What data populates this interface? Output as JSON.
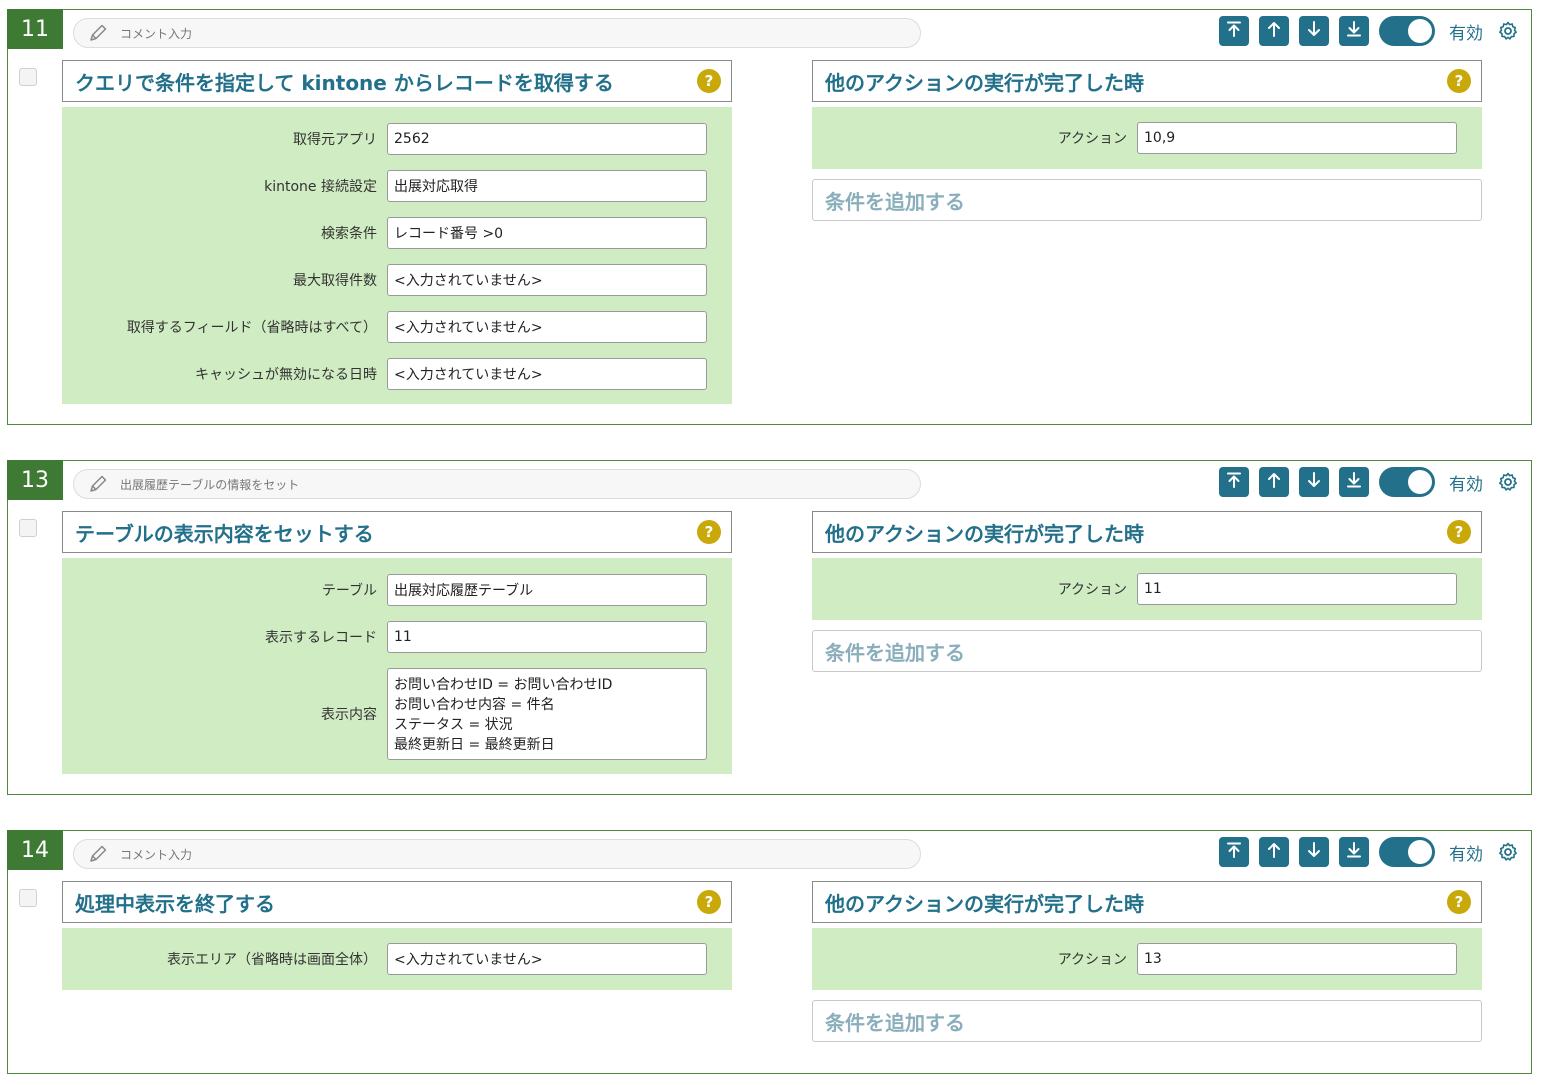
{
  "colors": {
    "accent": "#22708a",
    "block_number_bg": "#3f7a34",
    "panel_bg": "#d0ecc3",
    "help": "#c9a80a"
  },
  "toolbar": {
    "icons": [
      "move-top-icon",
      "move-up-icon",
      "move-down-icon",
      "move-bottom-icon"
    ],
    "enabled_label": "有効"
  },
  "blocks": [
    {
      "number": "11",
      "comment": "コメント入力",
      "action_title": "クエリで条件を指定して kintone からレコードを取得する",
      "fields": [
        {
          "label": "取得元アプリ",
          "value": "2562"
        },
        {
          "label": "kintone 接続設定",
          "value": "出展対応取得"
        },
        {
          "label": "検索条件",
          "value": "レコード番号 >0"
        },
        {
          "label": "最大取得件数",
          "value": "<入力されていません>"
        },
        {
          "label": "取得するフィールド（省略時はすべて）",
          "value": "<入力されていません>"
        },
        {
          "label": "キャッシュが無効になる日時",
          "value": "<入力されていません>"
        }
      ],
      "trigger_title": "他のアクションの実行が完了した時",
      "trigger_label": "アクション",
      "trigger_value": "10,9",
      "add_condition": "条件を追加する"
    },
    {
      "number": "13",
      "comment": "出展履歴テーブルの情報をセット",
      "action_title": "テーブルの表示内容をセットする",
      "fields": [
        {
          "label": "テーブル",
          "value": "出展対応履歴テーブル"
        },
        {
          "label": "表示するレコード",
          "value": "11"
        },
        {
          "label": "表示内容",
          "value": "お問い合わせID = お問い合わせID\nお問い合わせ内容 = 件名\nステータス = 状況\n最終更新日 = 最終更新日"
        }
      ],
      "trigger_title": "他のアクションの実行が完了した時",
      "trigger_label": "アクション",
      "trigger_value": "11",
      "add_condition": "条件を追加する"
    },
    {
      "number": "14",
      "comment": "コメント入力",
      "action_title": "処理中表示を終了する",
      "fields": [
        {
          "label": "表示エリア（省略時は画面全体）",
          "value": "<入力されていません>"
        }
      ],
      "trigger_title": "他のアクションの実行が完了した時",
      "trigger_label": "アクション",
      "trigger_value": "13",
      "add_condition": "条件を追加する"
    }
  ]
}
